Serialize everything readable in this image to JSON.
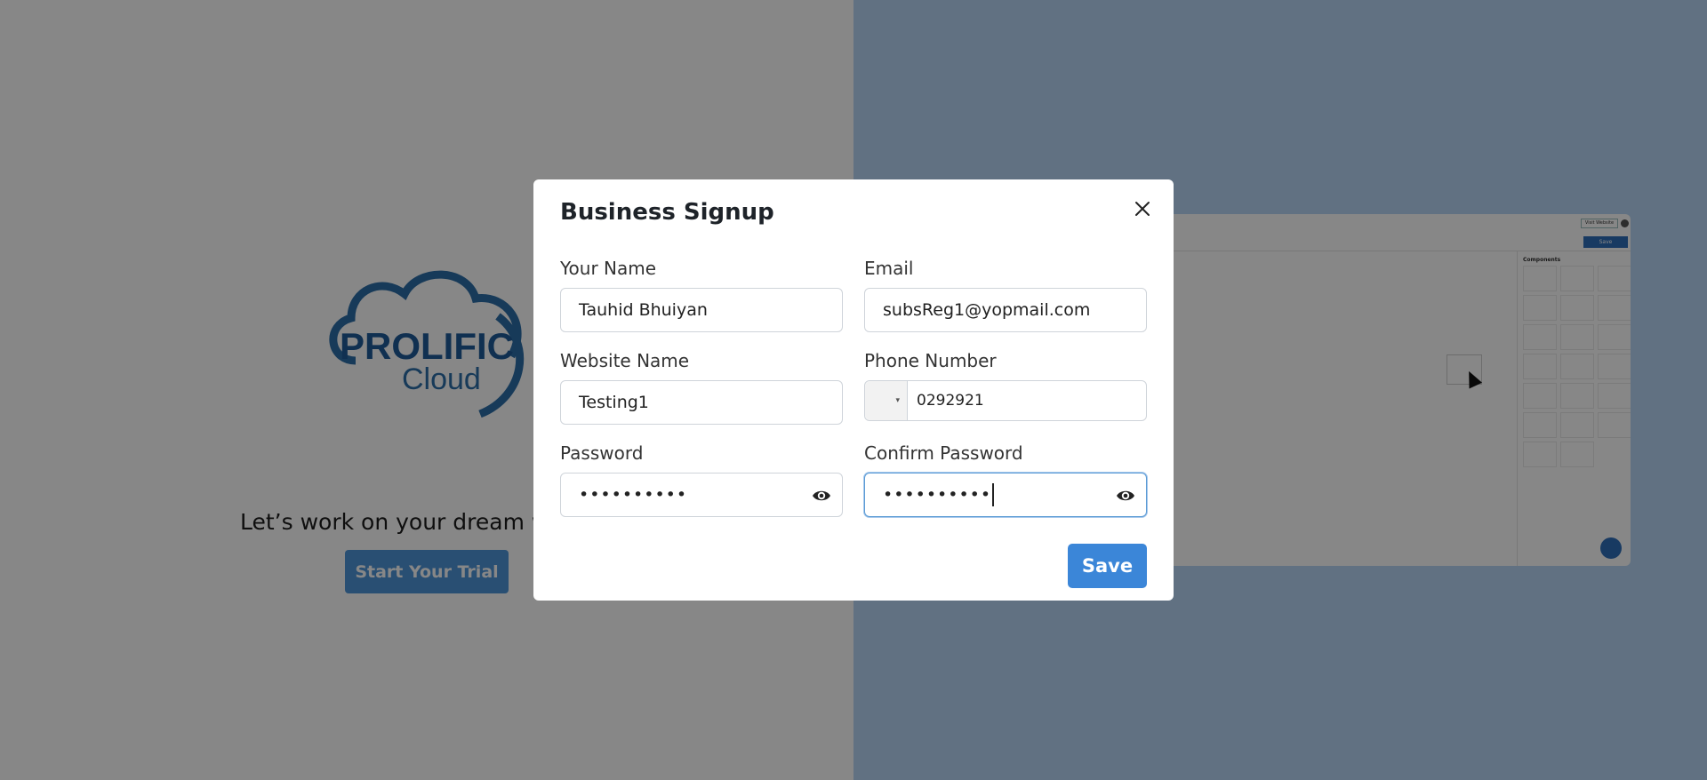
{
  "background": {
    "logo_text_1": "PROLIFIC",
    "logo_text_2": "Cloud",
    "tagline": "Let’s work on your dream w",
    "trial_button": "Start Your Trial",
    "preview": {
      "visit_website": "Visit Website",
      "save": "Save",
      "components_title": "Components"
    }
  },
  "modal": {
    "title": "Business Signup",
    "close_icon": "close-icon",
    "fields": {
      "your_name": {
        "label": "Your Name",
        "value": "Tauhid Bhuiyan"
      },
      "email": {
        "label": "Email",
        "value": "subsReg1@yopmail.com"
      },
      "website_name": {
        "label": "Website Name",
        "value": "Testing1"
      },
      "phone_number": {
        "label": "Phone Number",
        "value": "0292921",
        "country_dropdown": "▾"
      },
      "password": {
        "label": "Password",
        "value": "••••••••••"
      },
      "confirm_password": {
        "label": "Confirm Password",
        "value": "••••••••••"
      }
    },
    "save_button": "Save"
  },
  "colors": {
    "accent": "#3b86d8",
    "overlay": "rgba(0,0,0,0.47)",
    "focus_border": "#5b9bd5"
  }
}
